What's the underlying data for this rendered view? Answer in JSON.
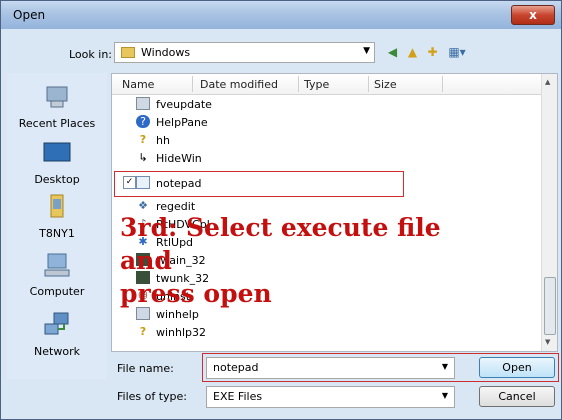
{
  "window": {
    "title": "Open",
    "close_glyph": "x"
  },
  "toolbar": {
    "look_in_label": "Look in:",
    "look_in_value": "Windows",
    "icons": [
      "back-icon",
      "up-folder-icon",
      "new-folder-icon",
      "views-icon"
    ]
  },
  "places": [
    {
      "label": "Recent Places",
      "icon": "recent-places-icon"
    },
    {
      "label": "Desktop",
      "icon": "desktop-icon"
    },
    {
      "label": "T8NY1",
      "icon": "user-folder-icon"
    },
    {
      "label": "Computer",
      "icon": "computer-icon"
    },
    {
      "label": "Network",
      "icon": "network-icon"
    }
  ],
  "columns": [
    "Name",
    "Date modified",
    "Type",
    "Size"
  ],
  "files": [
    {
      "name": "fveupdate",
      "icon": "app-icon"
    },
    {
      "name": "HelpPane",
      "icon": "help-icon"
    },
    {
      "name": "hh",
      "icon": "help-file-icon"
    },
    {
      "name": "HideWin",
      "icon": "shortcut-icon"
    },
    {
      "name": "notepad",
      "icon": "notepad-icon",
      "selected": true
    },
    {
      "name": "regedit",
      "icon": "regedit-icon"
    },
    {
      "name": "RtHDVCpl",
      "icon": "audio-icon"
    },
    {
      "name": "RtlUpd",
      "icon": "update-icon"
    },
    {
      "name": "twain_32",
      "icon": "twain-icon"
    },
    {
      "name": "twunk_32",
      "icon": "twain-icon"
    },
    {
      "name": "uninst",
      "icon": "uninstall-icon"
    },
    {
      "name": "winhelp",
      "icon": "app-icon"
    },
    {
      "name": "winhlp32",
      "icon": "help-file-icon"
    }
  ],
  "annotation": {
    "line1": "3rd: Select execute file and",
    "line2": "press open"
  },
  "filename": {
    "label": "File name:",
    "value": "notepad"
  },
  "filetype": {
    "label": "Files of type:",
    "value": "EXE Files"
  },
  "buttons": {
    "open": "Open",
    "cancel": "Cancel"
  }
}
